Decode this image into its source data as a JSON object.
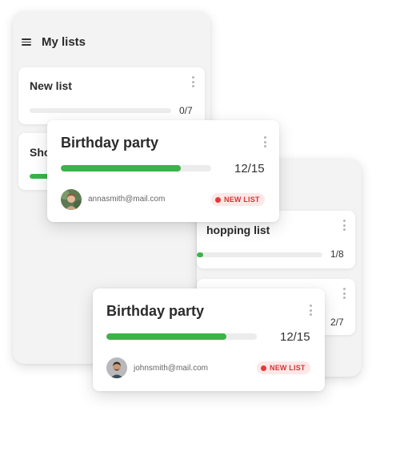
{
  "header": {
    "title": "My lists"
  },
  "colors": {
    "progress": "#3bb34a",
    "badge_text": "#d63434",
    "badge_bg": "#fde7e7"
  },
  "main_panel": {
    "cards": [
      {
        "title": "New list",
        "count": "0/7",
        "progress": 0
      },
      {
        "title": "Sho",
        "progress": 0.35
      }
    ]
  },
  "right_panel": {
    "cards": [
      {
        "title": "hopping list",
        "count": "1/8",
        "progress": 0.05
      },
      {
        "count": "2/7",
        "progress": 0.2
      }
    ]
  },
  "featured": [
    {
      "title": "Birthday party",
      "count": "12/15",
      "progress": 0.8,
      "email": "annasmith@mail.com",
      "badge": "NEW LIST",
      "avatar": "woman-avatar"
    },
    {
      "title": "Birthday party",
      "count": "12/15",
      "progress": 0.8,
      "email": "johnsmith@mail.com",
      "badge": "NEW LIST",
      "avatar": "man-avatar"
    }
  ]
}
